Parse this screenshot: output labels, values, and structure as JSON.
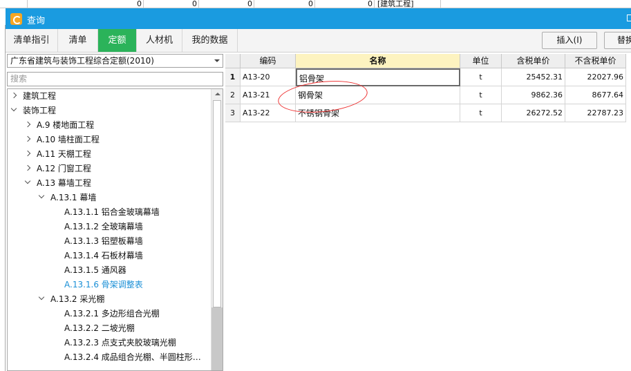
{
  "background": {
    "top_cells": [
      "0",
      "0",
      "0",
      "0",
      "0",
      "[建筑工程]"
    ]
  },
  "dialog": {
    "title": "查询",
    "tabs": [
      "清单指引",
      "清单",
      "定额",
      "人材机",
      "我的数据"
    ],
    "active_tab": "定额",
    "buttons": {
      "insert": "插入(I)",
      "replace": "替换"
    }
  },
  "left_panel": {
    "quota_library": "广东省建筑与装饰工程综合定额(2010)",
    "search_placeholder": "搜索",
    "tree": [
      {
        "label": "建筑工程",
        "expanded": false
      },
      {
        "label": "装饰工程",
        "expanded": true
      },
      {
        "label": "A.9 楼地面工程",
        "expanded": false
      },
      {
        "label": "A.10 墙柱面工程",
        "expanded": false
      },
      {
        "label": "A.11 天棚工程",
        "expanded": false
      },
      {
        "label": "A.12 门窗工程",
        "expanded": false
      },
      {
        "label": "A.13 幕墙工程",
        "expanded": true
      },
      {
        "label": "A.13.1 幕墙",
        "expanded": true
      },
      {
        "label": "A.13.1.1 铝合金玻璃幕墙"
      },
      {
        "label": "A.13.1.2 全玻璃幕墙"
      },
      {
        "label": "A.13.1.3 铝塑板幕墙"
      },
      {
        "label": "A.13.1.4 石板材幕墙"
      },
      {
        "label": "A.13.1.5 通风器"
      },
      {
        "label": "A.13.1.6 骨架调整表",
        "selected": true
      },
      {
        "label": "A.13.2 采光棚",
        "expanded": true
      },
      {
        "label": "A.13.2.1 多边形组合光棚"
      },
      {
        "label": "A.13.2.2 二坡光棚"
      },
      {
        "label": "A.13.2.3 点支式夹胶玻璃光棚"
      },
      {
        "label": "A.13.2.4 成品组合光棚、半圆柱形…"
      }
    ]
  },
  "grid": {
    "columns": [
      "编码",
      "名称",
      "单位",
      "含税单价",
      "不含税单价"
    ],
    "rows": [
      {
        "no": "1",
        "code": "A13-20",
        "name": "铝骨架",
        "unit": "t",
        "price_tax": "25452.31",
        "price_notax": "22027.96"
      },
      {
        "no": "2",
        "code": "A13-21",
        "name": "钢骨架",
        "unit": "t",
        "price_tax": "9862.36",
        "price_notax": "8677.64"
      },
      {
        "no": "3",
        "code": "A13-22",
        "name": "不锈钢骨架",
        "unit": "t",
        "price_tax": "26272.52",
        "price_notax": "22787.23"
      }
    ]
  },
  "colors": {
    "titlebar": "#1a9be0",
    "active_tab": "#2bb35a",
    "selected_tree_item": "#1a8fd6",
    "highlight_circle": "#e33333"
  }
}
